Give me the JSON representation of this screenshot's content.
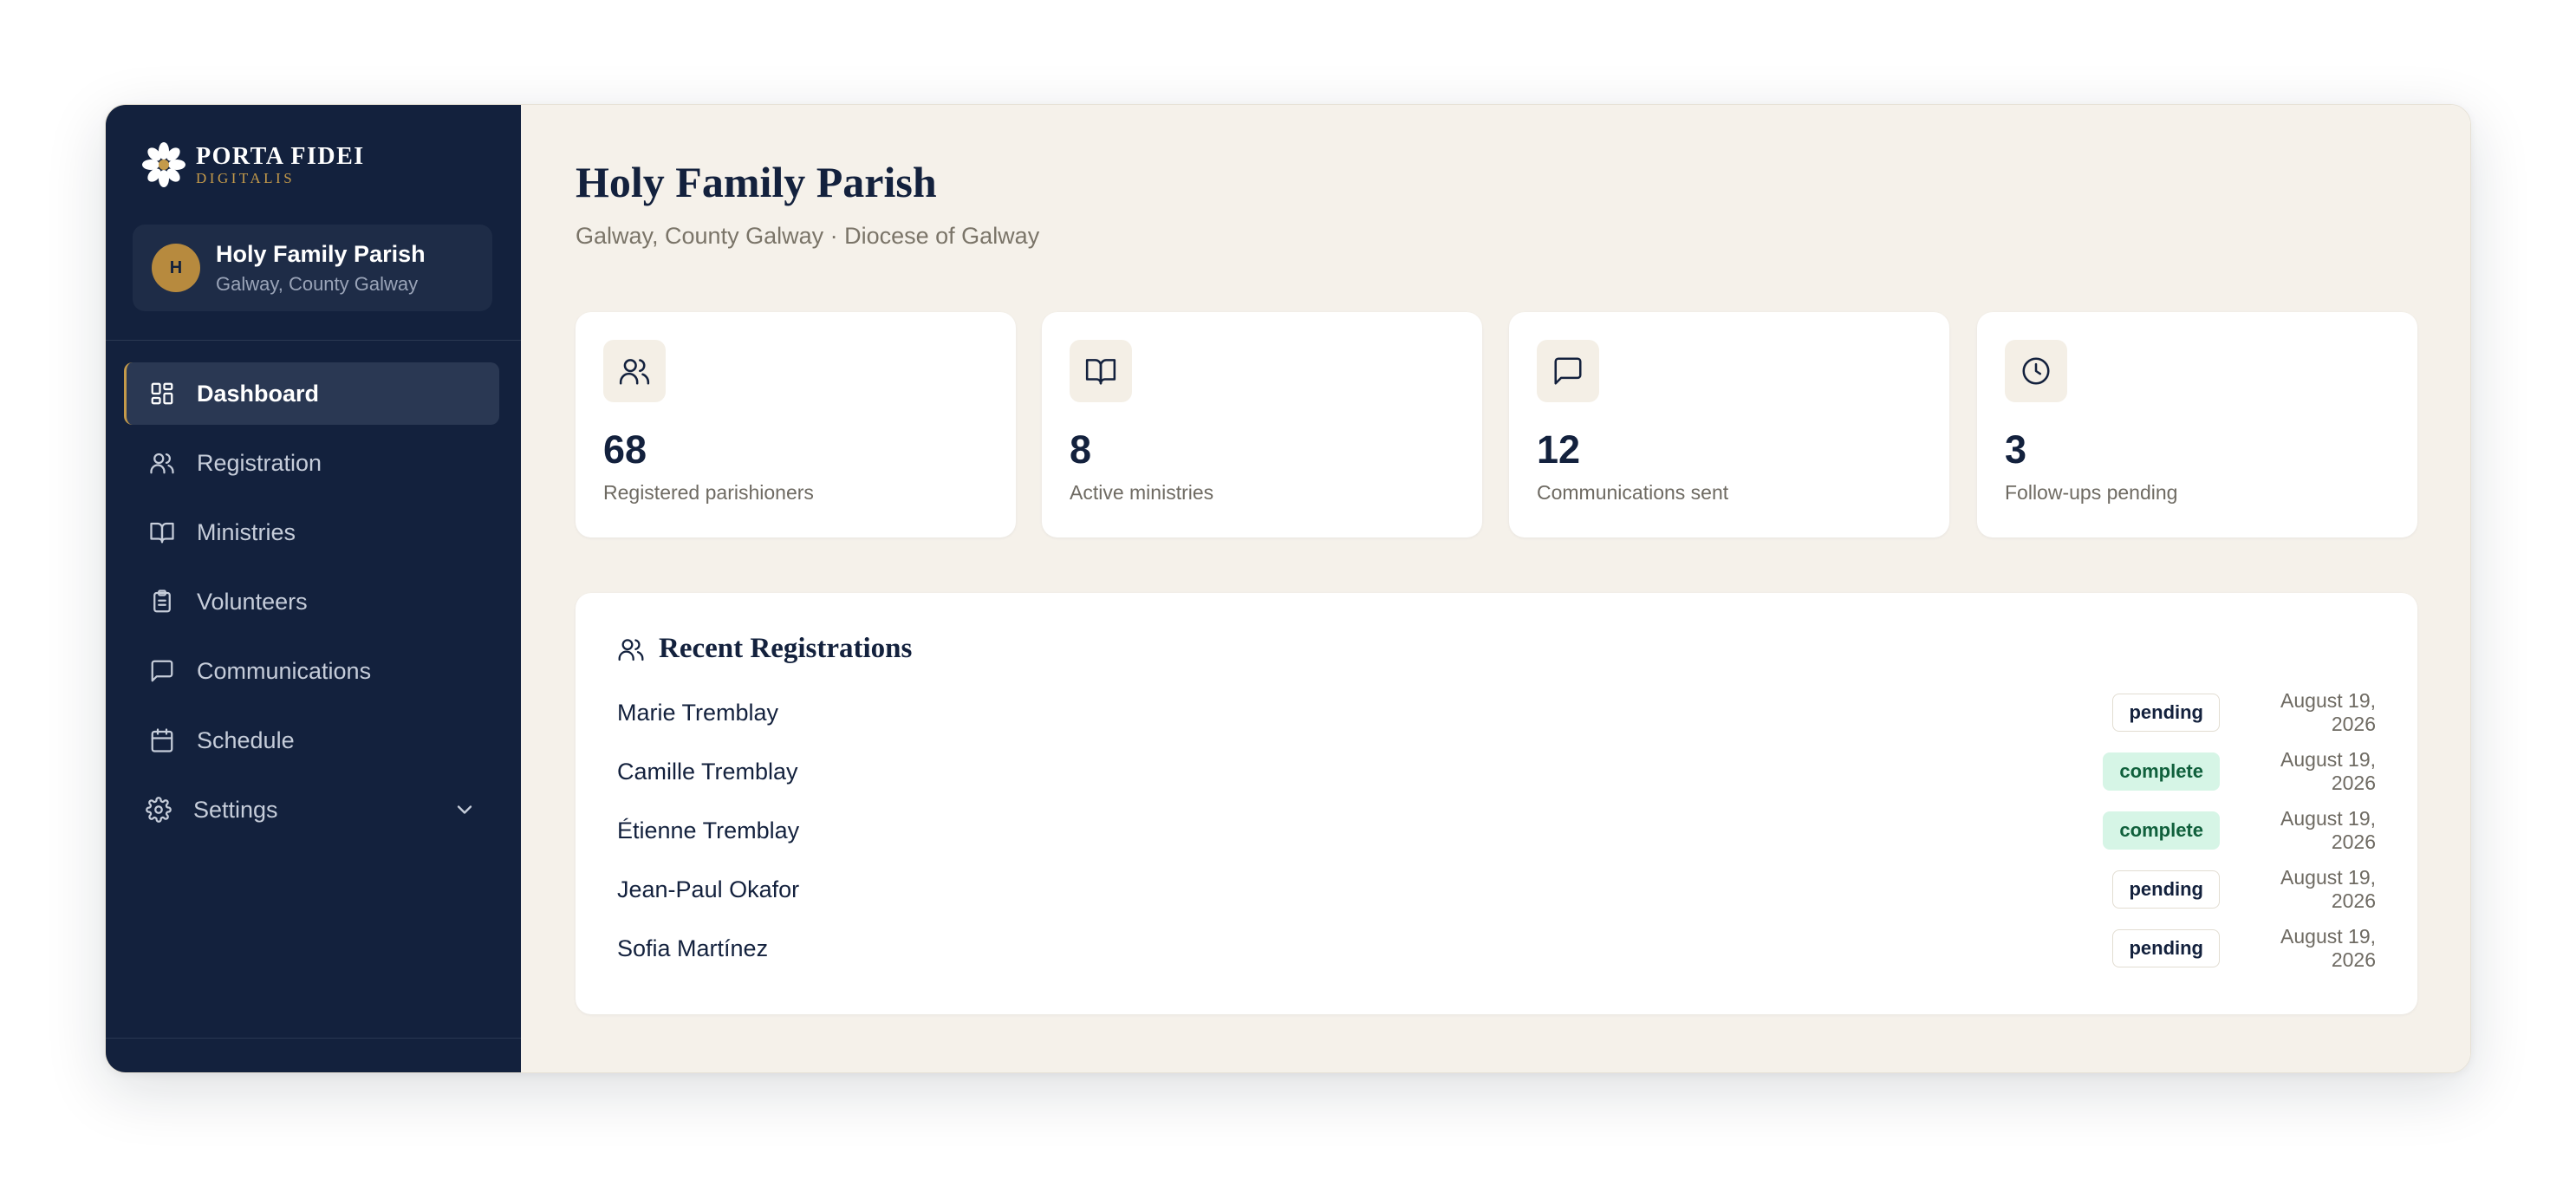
{
  "brand": {
    "name": "PORTA FIDEI",
    "sub": "DIGITALIS"
  },
  "parish_card": {
    "avatar_letter": "H",
    "name": "Holy Family Parish",
    "location": "Galway, County Galway"
  },
  "nav": {
    "items": [
      {
        "label": "Dashboard",
        "icon": "dashboard-icon",
        "active": true
      },
      {
        "label": "Registration",
        "icon": "users-icon"
      },
      {
        "label": "Ministries",
        "icon": "book-icon"
      },
      {
        "label": "Volunteers",
        "icon": "clipboard-icon"
      },
      {
        "label": "Communications",
        "icon": "message-icon"
      },
      {
        "label": "Schedule",
        "icon": "calendar-icon"
      },
      {
        "label": "Settings",
        "icon": "gear-icon",
        "expandable": true
      }
    ]
  },
  "header": {
    "title": "Holy Family Parish",
    "subtitle": "Galway, County Galway · Diocese of Galway"
  },
  "stats": [
    {
      "value": "68",
      "label": "Registered parishioners",
      "icon": "users-icon"
    },
    {
      "value": "8",
      "label": "Active ministries",
      "icon": "book-icon"
    },
    {
      "value": "12",
      "label": "Communications sent",
      "icon": "message-icon"
    },
    {
      "value": "3",
      "label": "Follow-ups pending",
      "icon": "clock-icon"
    }
  ],
  "recent": {
    "title": "Recent Registrations",
    "rows": [
      {
        "name": "Marie Tremblay",
        "status": "pending",
        "date": "August 19, 2026"
      },
      {
        "name": "Camille Tremblay",
        "status": "complete",
        "date": "August 19, 2026"
      },
      {
        "name": "Étienne Tremblay",
        "status": "complete",
        "date": "August 19, 2026"
      },
      {
        "name": "Jean-Paul Okafor",
        "status": "pending",
        "date": "August 19, 2026"
      },
      {
        "name": "Sofia Martínez",
        "status": "pending",
        "date": "August 19, 2026"
      }
    ]
  },
  "colors": {
    "sidebar": "#13213d",
    "accent_gold": "#c49a4a",
    "main_bg": "#f5f1ea",
    "complete_bg": "#d6f5e6"
  }
}
